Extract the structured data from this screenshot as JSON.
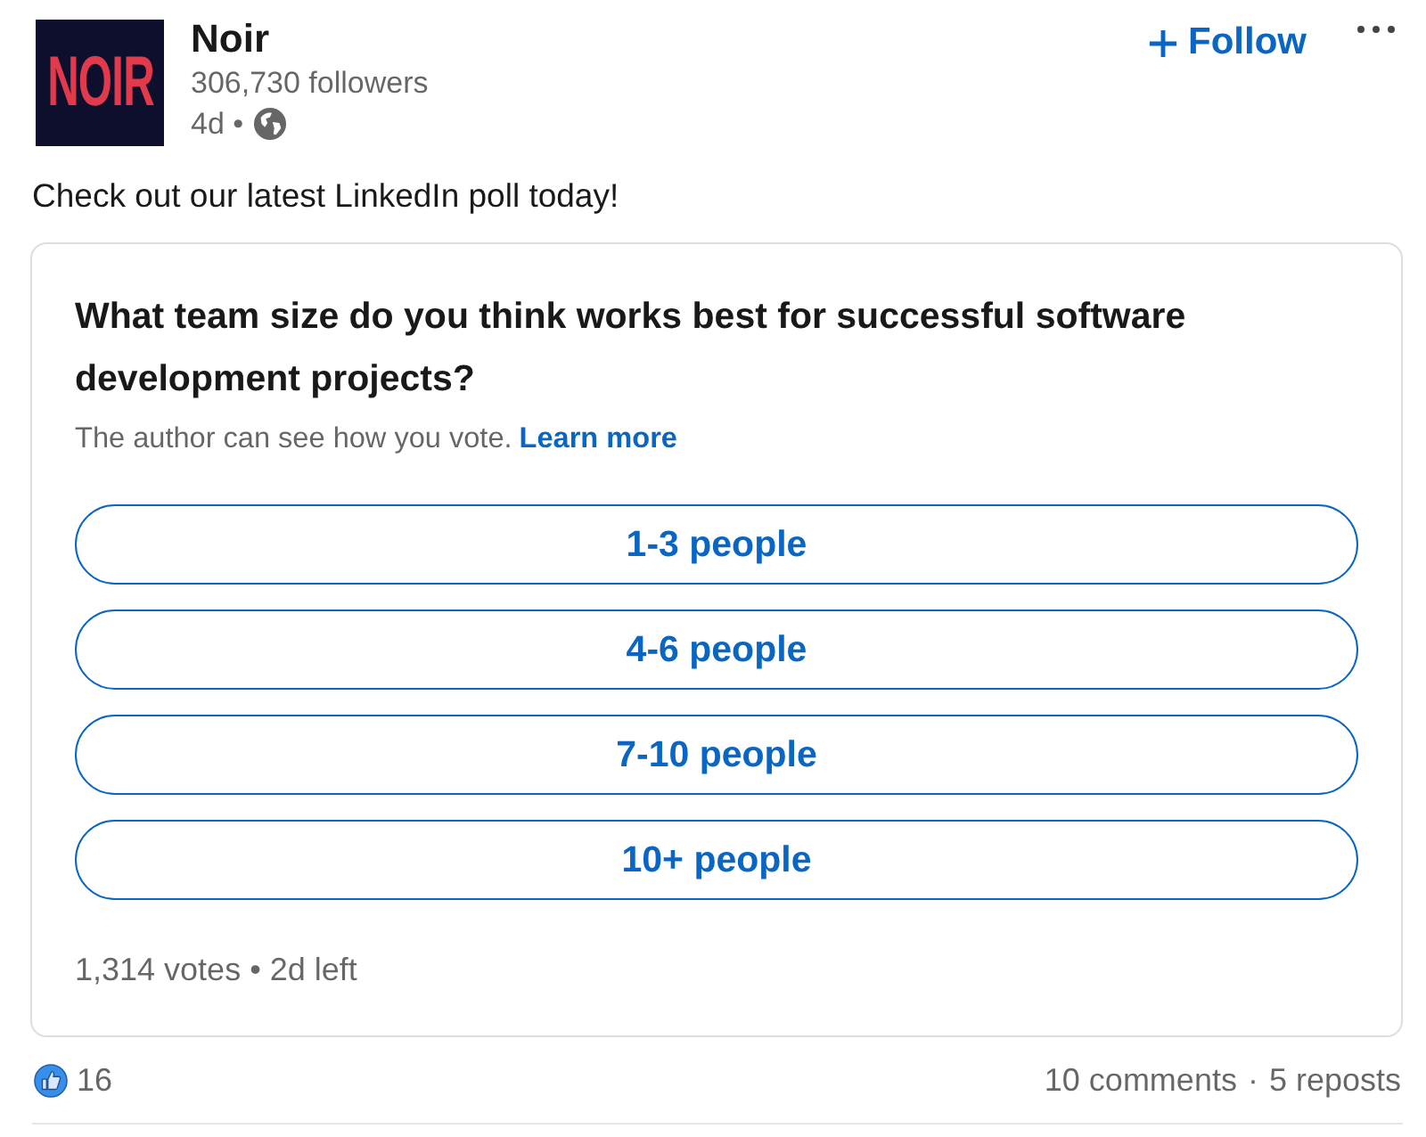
{
  "author": {
    "logo_text": "NOIR",
    "name": "Noir",
    "followers": "306,730 followers",
    "posted": "4d •"
  },
  "actions": {
    "follow_label": "Follow"
  },
  "post": {
    "text": "Check out our latest LinkedIn poll today!"
  },
  "poll": {
    "question": "What team size do you think works best for successful software development projects?",
    "notice": "The author can see how you vote.",
    "notice_link": "Learn more",
    "options": [
      {
        "label": "1-3 people",
        "selected": false
      },
      {
        "label": "4-6 people",
        "selected": false
      },
      {
        "label": "7-10 people",
        "selected": false
      },
      {
        "label": "10+ people",
        "selected": false
      }
    ],
    "summary": "1,314 votes • 2d left"
  },
  "social": {
    "reactions": "16",
    "comments": "10 comments",
    "separator": "·",
    "reposts": "5 reposts"
  }
}
